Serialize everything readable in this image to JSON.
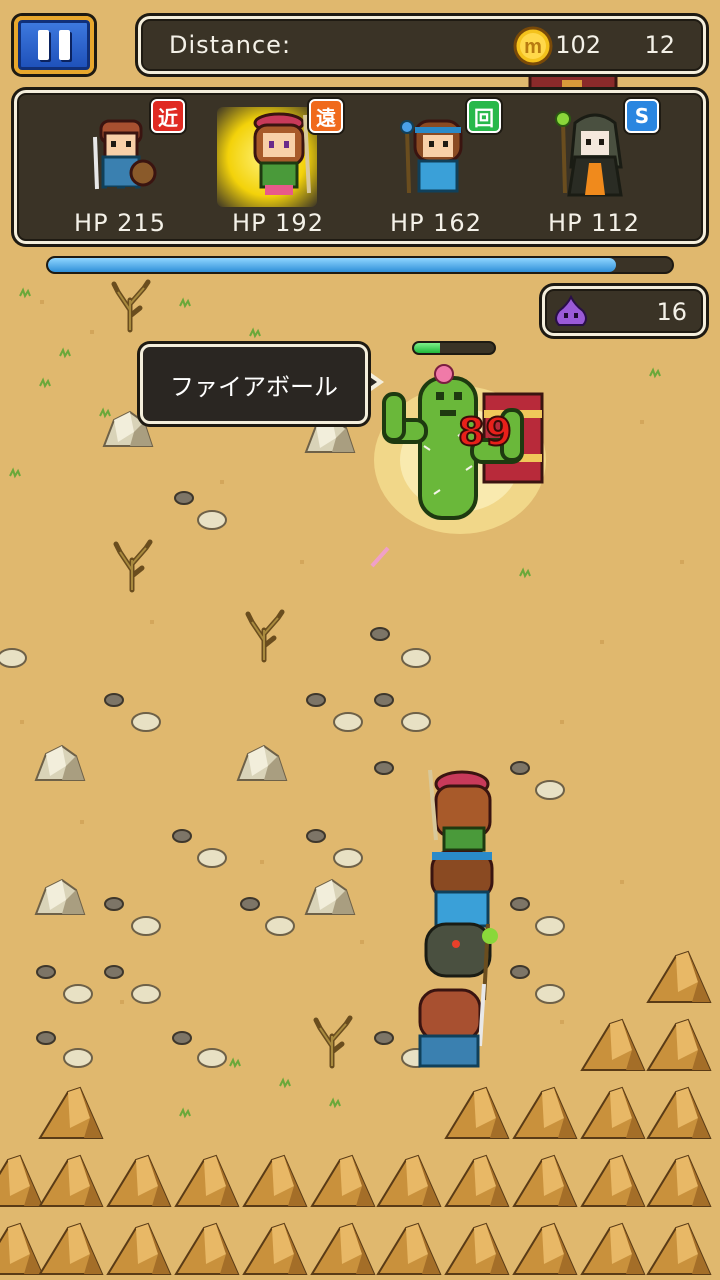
{
  "header": {
    "distance_label": "Distance:",
    "distance_value": "102",
    "coin_count": "12",
    "coin_icon": "coin-icon",
    "coin_letter": "m"
  },
  "party": [
    {
      "role_label": "近",
      "role_color": "#e02a22",
      "hp_text": "HP 215",
      "portrait": "swordsman-portrait"
    },
    {
      "role_label": "遠",
      "role_color": "#f06a1c",
      "hp_text": "HP 192",
      "portrait": "archer-portrait"
    },
    {
      "role_label": "回",
      "role_color": "#28b84a",
      "hp_text": "HP 162",
      "portrait": "healer-portrait"
    },
    {
      "role_label": "S",
      "role_color": "#2a86e0",
      "hp_text": "HP 112",
      "portrait": "mage-portrait"
    }
  ],
  "active_member_index": 1,
  "progress_fraction": 0.91,
  "slime": {
    "icon": "slime-icon",
    "count": "16"
  },
  "skill_bubble": {
    "text": "ファイアボール"
  },
  "enemy": {
    "name": "cactus-enemy",
    "hp_fraction": 0.33,
    "damage_text": "89"
  },
  "colors": {
    "sand": "#e0b86e",
    "panel": "#3a3326",
    "panel_border": "#f4eedc",
    "progress": "#2f8fd8",
    "damage": "#e8201a"
  }
}
